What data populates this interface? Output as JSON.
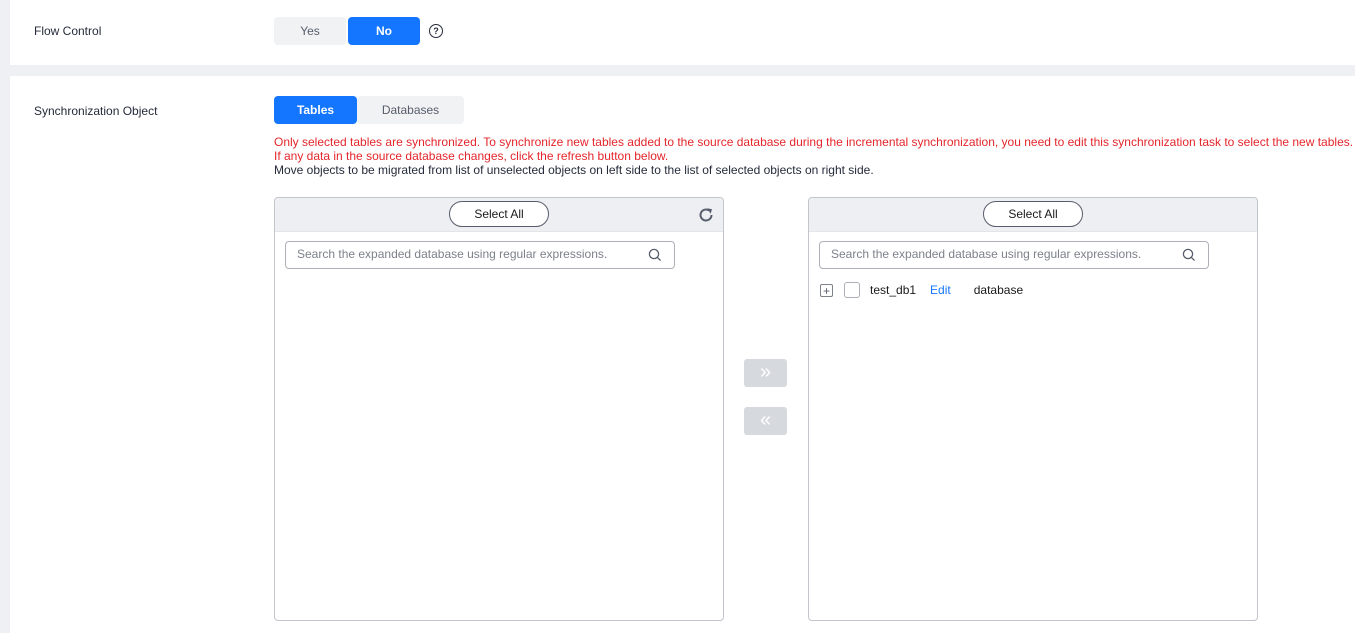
{
  "flow_control": {
    "label": "Flow Control",
    "options": [
      "Yes",
      "No"
    ],
    "selected": "No"
  },
  "sync_object": {
    "label": "Synchronization Object",
    "tabs": [
      "Tables",
      "Databases"
    ],
    "selected_tab": "Tables",
    "hint_line1": "Only selected tables are synchronized. To synchronize new tables added to the source database during the incremental synchronization, you need to edit this synchronization task to select the new tables.",
    "hint_line2": "If any data in the source database changes, click the refresh button below.",
    "hint_line3": "Move objects to be migrated from list of unselected objects on left side to the list of selected objects on right side."
  },
  "left_panel": {
    "select_all": "Select All",
    "search_placeholder": "Search the expanded database using regular expressions."
  },
  "right_panel": {
    "select_all": "Select All",
    "search_placeholder": "Search the expanded database using regular expressions.",
    "items": [
      {
        "expand": "+",
        "name": "test_db1",
        "edit": "Edit",
        "type": "database"
      }
    ]
  },
  "transfer": {
    "move_right": "»",
    "move_left": "«"
  },
  "colors": {
    "accent": "#1476ff",
    "warning_text": "#e4262b",
    "disabled_button": "#d6d9de"
  }
}
